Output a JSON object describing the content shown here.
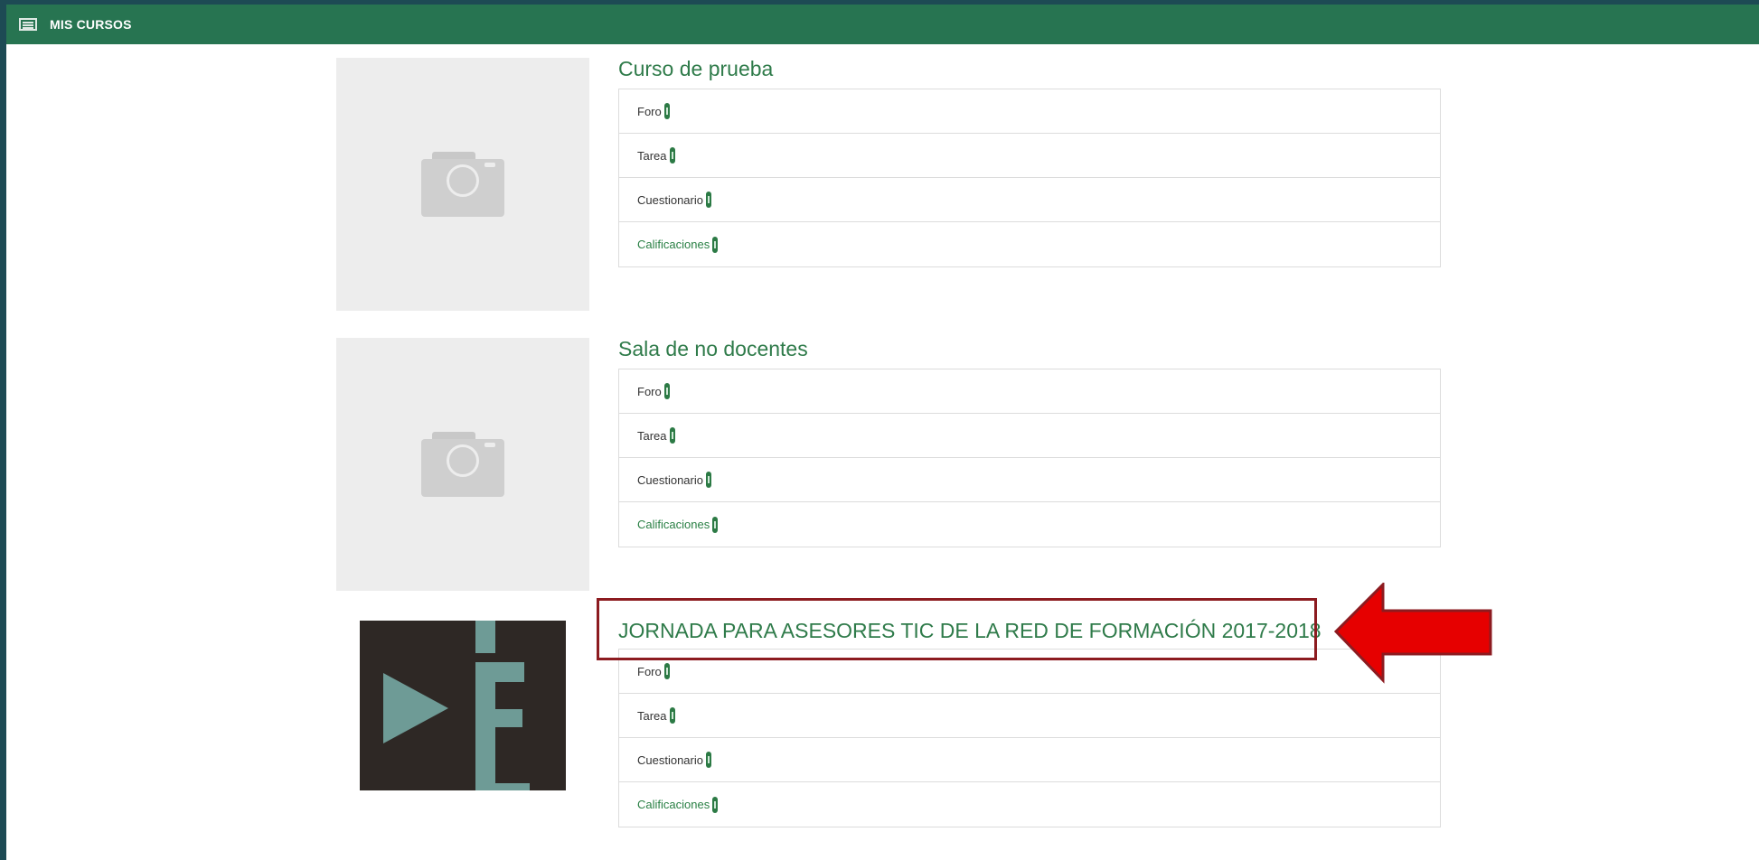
{
  "header": {
    "icon": "list-icon",
    "title": "MIS CURSOS",
    "bar_color": "#277451"
  },
  "courses": [
    {
      "title": "Curso de prueba",
      "image": "camera-placeholder-icon",
      "menu": [
        "Foro",
        "Tarea",
        "Cuestionario",
        "Calificaciones"
      ]
    },
    {
      "title": "Sala de no docentes",
      "image": "camera-placeholder-icon",
      "menu": [
        "Foro",
        "Tarea",
        "Cuestionario",
        "Calificaciones"
      ]
    },
    {
      "title": "JORNADA PARA ASESORES TIC DE LA RED DE FORMACIÓN 2017-2018",
      "image": "course-logo",
      "menu": [
        "Foro",
        "Tarea",
        "Cuestionario",
        "Calificaciones"
      ]
    }
  ],
  "annotation": {
    "highlight_color": "#8c1b20",
    "arrow_color": "#e60000"
  }
}
